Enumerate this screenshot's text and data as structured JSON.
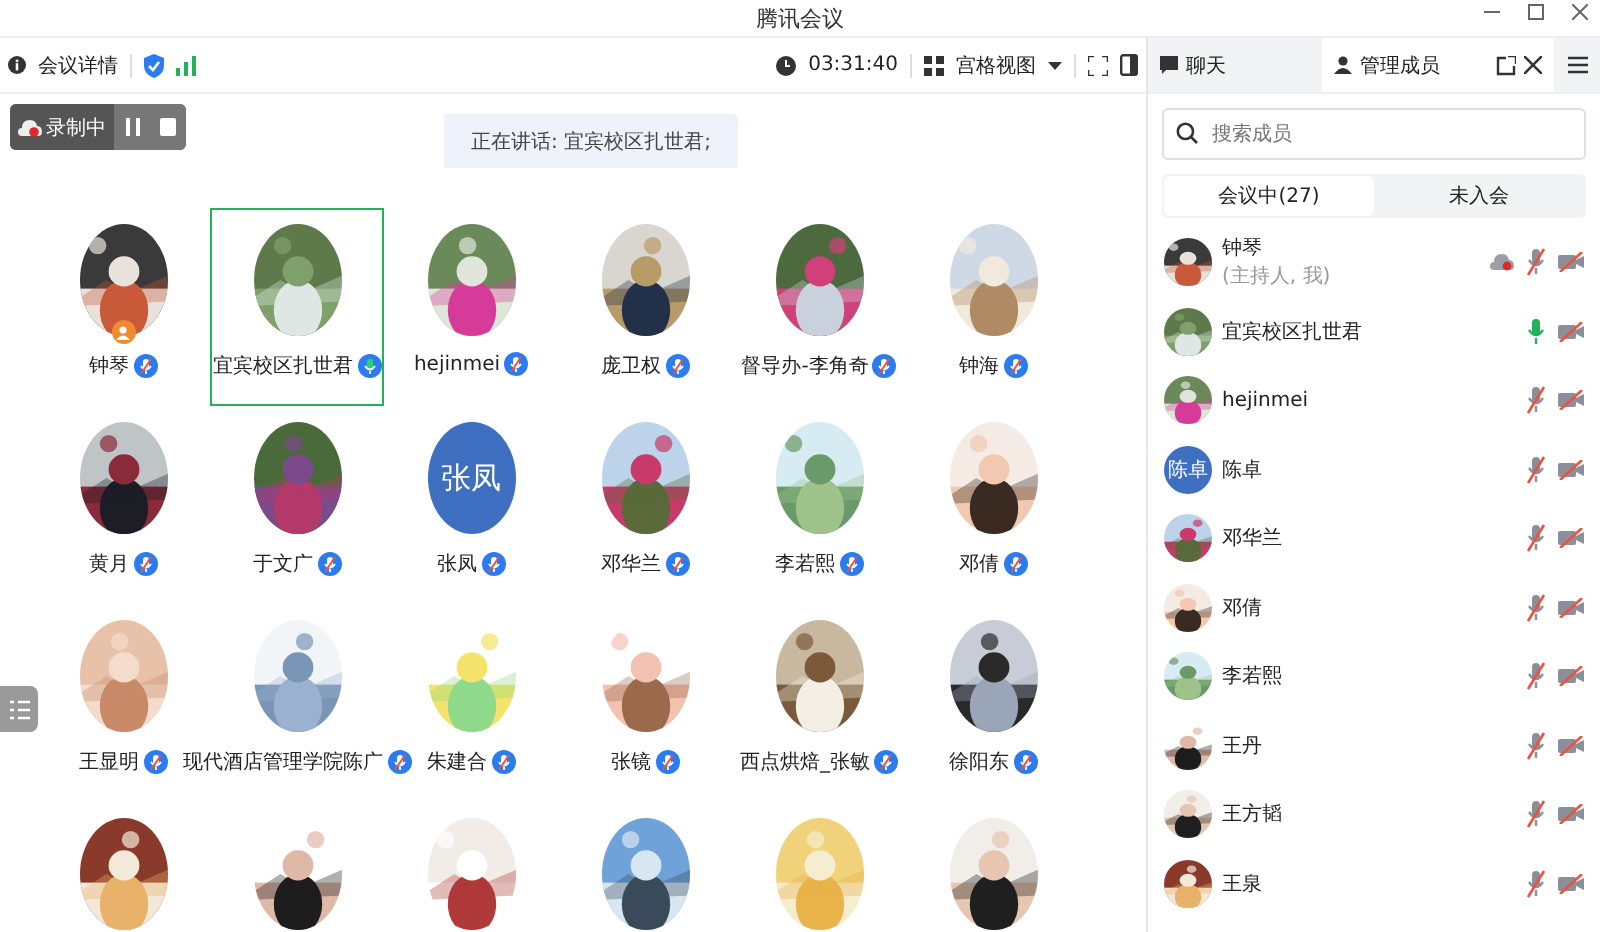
{
  "window": {
    "title": "腾讯会议"
  },
  "toolbar": {
    "details": "会议详情",
    "timer": "03:31:40",
    "view": "宫格视图"
  },
  "recording": {
    "label": "录制中"
  },
  "speaking": "正在讲话: 宜宾校区扎世君;",
  "tiles": [
    {
      "name": "钟琴",
      "muted": true,
      "selected": false,
      "host": true
    },
    {
      "name": "宜宾校区扎世君",
      "muted": false,
      "selected": true,
      "host": false
    },
    {
      "name": "hejinmei",
      "muted": true,
      "selected": false,
      "host": false
    },
    {
      "name": "庞卫权",
      "muted": true,
      "selected": false,
      "host": false
    },
    {
      "name": "督导办-李角奇",
      "muted": true,
      "selected": false,
      "host": false
    },
    {
      "name": "钟海",
      "muted": true,
      "selected": false,
      "host": false
    },
    {
      "name": "黄月",
      "muted": true,
      "selected": false,
      "host": false
    },
    {
      "name": "于文广",
      "muted": true,
      "selected": false,
      "host": false
    },
    {
      "name": "张凤",
      "avatar": {
        "kind": "text",
        "text": "张凤"
      },
      "muted": true,
      "selected": false,
      "host": false
    },
    {
      "name": "邓华兰",
      "muted": true,
      "selected": false,
      "host": false
    },
    {
      "name": "李若熙",
      "muted": true,
      "selected": false,
      "host": false
    },
    {
      "name": "邓倩",
      "muted": true,
      "selected": false,
      "host": false
    },
    {
      "name": "王显明",
      "muted": true,
      "selected": false,
      "host": false
    },
    {
      "name": "现代酒店管理学院陈广",
      "muted": true,
      "selected": false,
      "host": false
    },
    {
      "name": "朱建合",
      "muted": true,
      "selected": false,
      "host": false
    },
    {
      "name": "张镜",
      "muted": true,
      "selected": false,
      "host": false
    },
    {
      "name": "西点烘焙_张敏",
      "muted": true,
      "selected": false,
      "host": false
    },
    {
      "name": "徐阳东",
      "muted": true,
      "selected": false,
      "host": false
    },
    {
      "selected": false
    },
    {
      "selected": false
    },
    {
      "selected": false
    },
    {
      "selected": false
    },
    {
      "selected": false
    },
    {
      "selected": false
    }
  ],
  "panel": {
    "tabs": [
      {
        "label": "聊天",
        "selected": false
      },
      {
        "label": "管理成员",
        "selected": true
      }
    ],
    "search": {
      "placeholder": "搜索成员"
    },
    "segments": [
      {
        "label": "会议中(27)",
        "selected": true
      },
      {
        "label": "未入会",
        "selected": false
      }
    ],
    "members": [
      {
        "name": "钟琴",
        "note": "(主持人, 我)",
        "recording": true,
        "muted": true,
        "camera_off": true
      },
      {
        "name": "宜宾校区扎世君",
        "muted": false,
        "camera_off": true
      },
      {
        "name": "hejinmei",
        "muted": true,
        "camera_off": true
      },
      {
        "name": "陈卓",
        "avatar": {
          "kind": "text",
          "text": "陈卓"
        },
        "muted": true,
        "camera_off": true
      },
      {
        "name": "邓华兰",
        "muted": true,
        "camera_off": true
      },
      {
        "name": "邓倩",
        "muted": true,
        "camera_off": true
      },
      {
        "name": "李若熙",
        "muted": true,
        "camera_off": true
      },
      {
        "name": "王丹",
        "muted": true,
        "camera_off": true
      },
      {
        "name": "王方韬",
        "muted": true,
        "camera_off": true
      },
      {
        "name": "王泉",
        "muted": true,
        "camera_off": true
      }
    ]
  }
}
